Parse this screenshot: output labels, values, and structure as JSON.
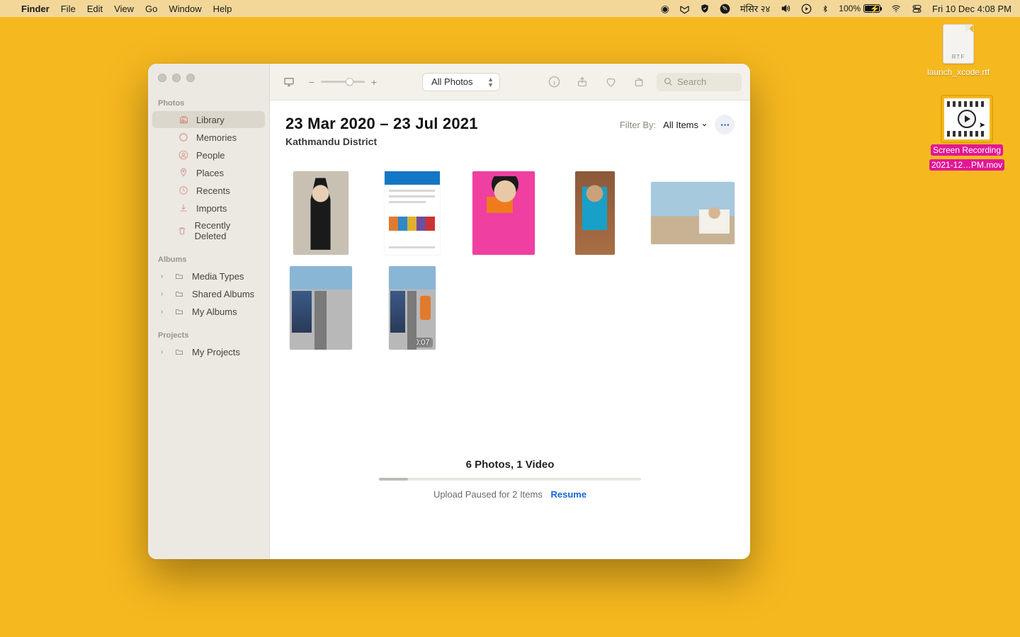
{
  "menubar": {
    "app": "Finder",
    "menus": [
      "File",
      "Edit",
      "View",
      "Go",
      "Window",
      "Help"
    ],
    "status": {
      "calendar": "मंसिर २४",
      "battery_pct": "100%",
      "datetime": "Fri 10 Dec  4:08 PM"
    }
  },
  "desktop": {
    "rtf": {
      "badge": "RTF",
      "label": "launch_xcode.rtf"
    },
    "mov": {
      "label_l1": "Screen Recording",
      "label_l2": "2021-12…PM.mov"
    }
  },
  "sidebar": {
    "sections": {
      "photos": {
        "heading": "Photos",
        "items": [
          "Library",
          "Memories",
          "People",
          "Places",
          "Recents",
          "Imports",
          "Recently Deleted"
        ]
      },
      "albums": {
        "heading": "Albums",
        "items": [
          "Media Types",
          "Shared Albums",
          "My Albums"
        ]
      },
      "projects": {
        "heading": "Projects",
        "items": [
          "My Projects"
        ]
      }
    }
  },
  "toolbar": {
    "view_select": "All Photos",
    "search_placeholder": "Search"
  },
  "header": {
    "title": "23 Mar 2020 – 23 Jul 2021",
    "subtitle": "Kathmandu District",
    "filter_label": "Filter By:",
    "filter_value": "All Items"
  },
  "grid": {
    "video_duration": "0:07"
  },
  "footer": {
    "summary": "6 Photos, 1 Video",
    "upload_text": "Upload Paused for 2 Items",
    "resume": "Resume"
  }
}
